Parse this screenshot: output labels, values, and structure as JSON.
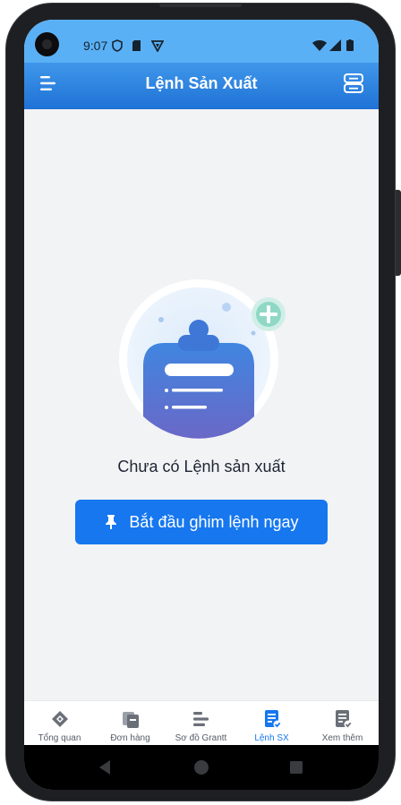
{
  "status_bar": {
    "time": "9:07"
  },
  "header": {
    "title": "Lệnh Sản Xuất"
  },
  "empty_state": {
    "message": "Chưa có Lệnh sản xuất",
    "button_label": "Bắt đầu ghim lệnh ngay"
  },
  "tabs": [
    {
      "label": "Tổng quan",
      "icon": "diamond-icon"
    },
    {
      "label": "Đơn hàng",
      "icon": "orders-icon"
    },
    {
      "label": "Sơ đồ Grantt",
      "icon": "gantt-icon"
    },
    {
      "label": "Lệnh SX",
      "icon": "production-order-icon",
      "active": true
    },
    {
      "label": "Xem thêm",
      "icon": "more-list-icon"
    }
  ],
  "colors": {
    "primary": "#1677ef",
    "header": "#2c86e2",
    "background": "#f2f3f5"
  }
}
